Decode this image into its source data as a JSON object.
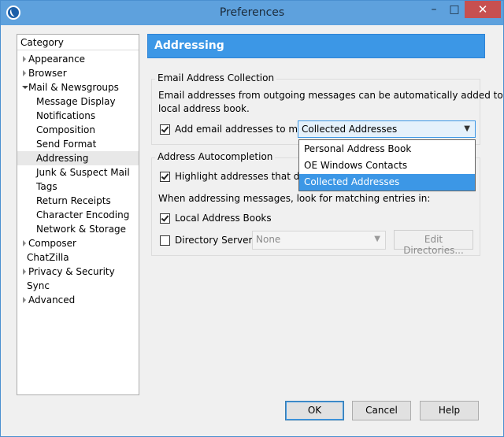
{
  "window": {
    "title": "Preferences",
    "minimize_glyph": "–",
    "maximize_glyph": "□",
    "close_glyph": "✕"
  },
  "category": {
    "header": "Category",
    "items": [
      {
        "label": "Appearance",
        "expandable": true
      },
      {
        "label": "Browser",
        "expandable": true
      },
      {
        "label": "Mail & Newsgroups",
        "expandable": true,
        "expanded": true
      },
      {
        "label": "Message Display"
      },
      {
        "label": "Notifications"
      },
      {
        "label": "Composition"
      },
      {
        "label": "Send Format"
      },
      {
        "label": "Addressing",
        "selected": true
      },
      {
        "label": "Junk & Suspect Mail"
      },
      {
        "label": "Tags"
      },
      {
        "label": "Return Receipts"
      },
      {
        "label": "Character Encoding"
      },
      {
        "label": "Network & Storage"
      },
      {
        "label": "Composer",
        "expandable": true
      },
      {
        "label": "ChatZilla"
      },
      {
        "label": "Privacy & Security",
        "expandable": true
      },
      {
        "label": "Sync"
      },
      {
        "label": "Advanced",
        "expandable": true
      }
    ]
  },
  "pane": {
    "title": "Addressing"
  },
  "collection": {
    "caption": "Email Address Collection",
    "description_line1": "Email addresses from outgoing messages can be automatically added to a",
    "description_line2": "local address book.",
    "add_checkbox_label": "Add email addresses to my:",
    "add_checked": true,
    "selected_book": "Collected Addresses",
    "popup_options": [
      "Personal Address Book",
      "OE Windows Contacts",
      "Collected Addresses"
    ],
    "popup_selected": "Collected Addresses"
  },
  "autocompletion": {
    "caption": "Address Autocompletion",
    "highlight_label": "Highlight addresses that do no",
    "highlight_checked": true,
    "lookup_text": "When addressing messages, look for matching entries in:",
    "local_books_label": "Local Address Books",
    "local_books_checked": true,
    "directory_server_label": "Directory Server:",
    "directory_server_checked": false,
    "directory_server_value": "None",
    "edit_directories_label": "Edit Directories..."
  },
  "buttons": {
    "ok": "OK",
    "cancel": "Cancel",
    "help": "Help"
  }
}
